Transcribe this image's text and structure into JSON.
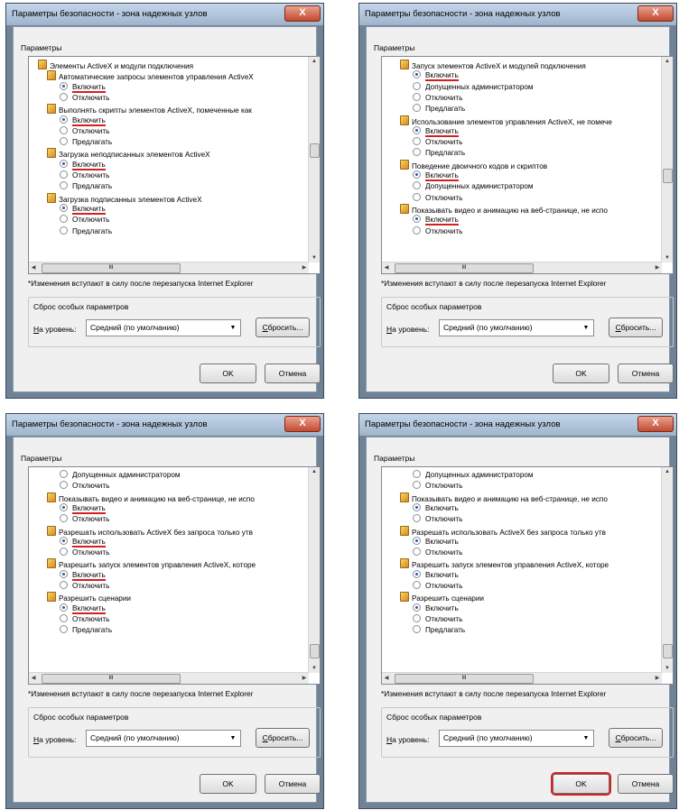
{
  "dialog": {
    "title": "Параметры безопасности - зона надежных узлов",
    "close_label": "X",
    "group_label": "Параметры",
    "note": "*Изменения вступают в силу после перезапуска Internet Explorer",
    "reset_group_title": "Сброс особых параметров",
    "level_label": "На уровень:",
    "level_value": "Средний (по умолчанию)",
    "reset_button": "Сбросить...",
    "ok_button": "OK",
    "cancel_button": "Отмена",
    "hscroll_grip": "III"
  },
  "panels": [
    {
      "items": [
        {
          "t": "h",
          "x": 0,
          "text": "Элементы ActiveX и модули подключения"
        },
        {
          "t": "h",
          "x": 10,
          "text": "Автоматические запросы элементов управления ActiveX"
        },
        {
          "t": "r",
          "on": true,
          "u": true,
          "text": "Включить"
        },
        {
          "t": "r",
          "on": false,
          "u": false,
          "text": "Отключить"
        },
        {
          "t": "h",
          "x": 10,
          "text": "Выполнять скрипты элементов ActiveX, помеченные как"
        },
        {
          "t": "r",
          "on": true,
          "u": true,
          "text": "Включить"
        },
        {
          "t": "r",
          "on": false,
          "u": false,
          "text": "Отключить"
        },
        {
          "t": "r",
          "on": false,
          "u": false,
          "text": "Предлагать"
        },
        {
          "t": "h",
          "x": 10,
          "text": "Загрузка неподписанных элементов ActiveX"
        },
        {
          "t": "r",
          "on": true,
          "u": true,
          "text": "Включить"
        },
        {
          "t": "r",
          "on": false,
          "u": false,
          "text": "Отключить"
        },
        {
          "t": "r",
          "on": false,
          "u": false,
          "text": "Предлагать"
        },
        {
          "t": "h",
          "x": 10,
          "text": "Загрузка подписанных элементов ActiveX"
        },
        {
          "t": "r",
          "on": true,
          "u": true,
          "text": "Включить"
        },
        {
          "t": "r",
          "on": false,
          "u": false,
          "text": "Отключить"
        },
        {
          "t": "r",
          "on": false,
          "u": false,
          "text": "Предлагать"
        }
      ],
      "ok_highlight": false
    },
    {
      "items": [
        {
          "t": "h",
          "x": 10,
          "text": "Запуск элементов ActiveX и модулей подключения"
        },
        {
          "t": "r",
          "on": true,
          "u": true,
          "text": "Включить"
        },
        {
          "t": "r",
          "on": false,
          "u": false,
          "text": "Допущенных администратором"
        },
        {
          "t": "r",
          "on": false,
          "u": false,
          "text": "Отключить"
        },
        {
          "t": "r",
          "on": false,
          "u": false,
          "text": "Предлагать"
        },
        {
          "t": "h",
          "x": 10,
          "text": "Использование элементов управления ActiveX, не помече"
        },
        {
          "t": "r",
          "on": true,
          "u": true,
          "text": "Включить"
        },
        {
          "t": "r",
          "on": false,
          "u": false,
          "text": "Отключить"
        },
        {
          "t": "r",
          "on": false,
          "u": false,
          "text": "Предлагать"
        },
        {
          "t": "h",
          "x": 10,
          "text": "Поведение двоичного кодов и скриптов"
        },
        {
          "t": "r",
          "on": true,
          "u": true,
          "text": "Включить"
        },
        {
          "t": "r",
          "on": false,
          "u": false,
          "text": "Допущенных администратором"
        },
        {
          "t": "r",
          "on": false,
          "u": false,
          "text": "Отключить"
        },
        {
          "t": "h",
          "x": 10,
          "text": "Показывать видео и анимацию на веб-странице, не испо"
        },
        {
          "t": "r",
          "on": true,
          "u": true,
          "text": "Включить"
        },
        {
          "t": "r",
          "on": false,
          "u": false,
          "text": "Отключить"
        }
      ],
      "ok_highlight": false
    },
    {
      "items": [
        {
          "t": "r",
          "on": false,
          "u": false,
          "text": "Допущенных администратором"
        },
        {
          "t": "r",
          "on": false,
          "u": false,
          "text": "Отключить"
        },
        {
          "t": "h",
          "x": 10,
          "text": "Показывать видео и анимацию на веб-странице, не испо"
        },
        {
          "t": "r",
          "on": true,
          "u": true,
          "text": "Включить"
        },
        {
          "t": "r",
          "on": false,
          "u": false,
          "text": "Отключить"
        },
        {
          "t": "h",
          "x": 10,
          "text": "Разрешать использовать ActiveX без запроса только утв"
        },
        {
          "t": "r",
          "on": true,
          "u": true,
          "text": "Включить"
        },
        {
          "t": "r",
          "on": false,
          "u": false,
          "text": "Отключить"
        },
        {
          "t": "h",
          "x": 10,
          "text": "Разрешить запуск элементов управления ActiveX, которе"
        },
        {
          "t": "r",
          "on": true,
          "u": true,
          "text": "Включить"
        },
        {
          "t": "r",
          "on": false,
          "u": false,
          "text": "Отключить"
        },
        {
          "t": "h",
          "x": 10,
          "text": "Разрешить сценарии"
        },
        {
          "t": "r",
          "on": true,
          "u": true,
          "text": "Включить"
        },
        {
          "t": "r",
          "on": false,
          "u": false,
          "text": "Отключить"
        },
        {
          "t": "r",
          "on": false,
          "u": false,
          "text": "Предлагать"
        }
      ],
      "ok_highlight": false
    },
    {
      "items": [
        {
          "t": "r",
          "on": false,
          "u": false,
          "text": "Допущенных администратором"
        },
        {
          "t": "r",
          "on": false,
          "u": false,
          "text": "Отключить"
        },
        {
          "t": "h",
          "x": 10,
          "text": "Показывать видео и анимацию на веб-странице, не испо"
        },
        {
          "t": "r",
          "on": true,
          "u": false,
          "text": "Включить"
        },
        {
          "t": "r",
          "on": false,
          "u": false,
          "text": "Отключить"
        },
        {
          "t": "h",
          "x": 10,
          "text": "Разрешать использовать ActiveX без запроса только утв"
        },
        {
          "t": "r",
          "on": true,
          "u": false,
          "text": "Включить"
        },
        {
          "t": "r",
          "on": false,
          "u": false,
          "text": "Отключить"
        },
        {
          "t": "h",
          "x": 10,
          "text": "Разрешить запуск элементов управления ActiveX, которе"
        },
        {
          "t": "r",
          "on": true,
          "u": false,
          "text": "Включить"
        },
        {
          "t": "r",
          "on": false,
          "u": false,
          "text": "Отключить"
        },
        {
          "t": "h",
          "x": 10,
          "text": "Разрешить сценарии"
        },
        {
          "t": "r",
          "on": true,
          "u": false,
          "text": "Включить"
        },
        {
          "t": "r",
          "on": false,
          "u": false,
          "text": "Отключить"
        },
        {
          "t": "r",
          "on": false,
          "u": false,
          "text": "Предлагать"
        }
      ],
      "ok_highlight": true
    }
  ],
  "colors": {
    "underline": "#d42020",
    "window_frame": "#6f8296",
    "close_button": "#c24a32"
  }
}
